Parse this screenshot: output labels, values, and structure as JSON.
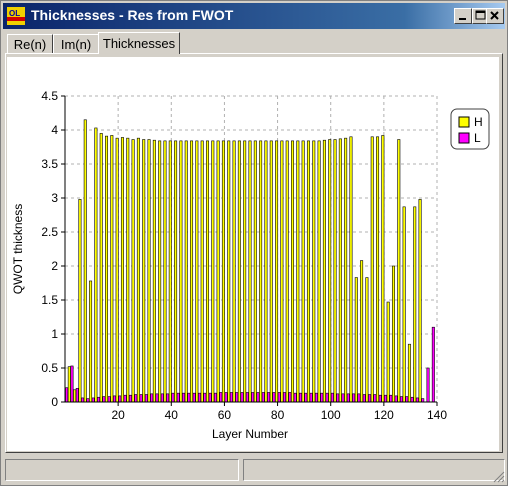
{
  "window": {
    "title": "Thicknesses - Res from FWOT",
    "icon": "ol-app-icon",
    "buttons": [
      "minimize-icon",
      "maximize-icon",
      "close-icon"
    ]
  },
  "tabs": [
    {
      "label": "Re(n)",
      "active": false
    },
    {
      "label": "Im(n)",
      "active": false
    },
    {
      "label": "Thicknesses",
      "active": true
    }
  ],
  "colors": {
    "H": "#ffff00",
    "L": "#ff00ff",
    "grid": "#b0b0b0"
  },
  "chart_data": {
    "type": "bar",
    "xlabel": "Layer Number",
    "ylabel": "QWOT thickness",
    "ylim": [
      0,
      4.5
    ],
    "xlim": [
      0,
      140
    ],
    "yticks": [
      "0",
      "0.5",
      "1",
      "1.5",
      "2",
      "2.5",
      "3",
      "3.5",
      "4",
      "4.5"
    ],
    "xticks": [
      "20",
      "40",
      "60",
      "80",
      "100",
      "120",
      "140"
    ],
    "grid": true,
    "legend_position": "top-right",
    "series": [
      {
        "name": "H",
        "x": [
          2,
          4,
          6,
          8,
          10,
          12,
          14,
          16,
          18,
          20,
          22,
          24,
          26,
          28,
          30,
          32,
          34,
          36,
          38,
          40,
          42,
          44,
          46,
          48,
          50,
          52,
          54,
          56,
          58,
          60,
          62,
          64,
          66,
          68,
          70,
          72,
          74,
          76,
          78,
          80,
          82,
          84,
          86,
          88,
          90,
          92,
          94,
          96,
          98,
          100,
          102,
          104,
          106,
          108,
          110,
          112,
          114,
          116,
          118,
          120,
          122,
          124,
          126,
          128,
          130,
          132,
          134,
          136,
          138,
          140
        ],
        "values": [
          0.52,
          0.18,
          2.98,
          4.15,
          1.78,
          4.03,
          3.95,
          3.91,
          3.92,
          3.88,
          3.89,
          3.88,
          3.86,
          3.88,
          3.86,
          3.86,
          3.85,
          3.84,
          3.84,
          3.84,
          3.84,
          3.84,
          3.84,
          3.84,
          3.84,
          3.84,
          3.84,
          3.84,
          3.84,
          3.84,
          3.84,
          3.84,
          3.84,
          3.84,
          3.84,
          3.84,
          3.84,
          3.84,
          3.84,
          3.84,
          3.84,
          3.84,
          3.84,
          3.84,
          3.84,
          3.84,
          3.84,
          3.84,
          3.85,
          3.86,
          3.86,
          3.87,
          3.88,
          3.9,
          1.83,
          2.08,
          1.83,
          3.9,
          3.9,
          3.92,
          1.47,
          2.0,
          3.86,
          2.87,
          0.85,
          2.87,
          2.98,
          0.0,
          0.0,
          0.0
        ]
      },
      {
        "name": "L",
        "x": [
          1,
          3,
          5,
          7,
          9,
          11,
          13,
          15,
          17,
          19,
          21,
          23,
          25,
          27,
          29,
          31,
          33,
          35,
          37,
          39,
          41,
          43,
          45,
          47,
          49,
          51,
          53,
          55,
          57,
          59,
          61,
          63,
          65,
          67,
          69,
          71,
          73,
          75,
          77,
          79,
          81,
          83,
          85,
          87,
          89,
          91,
          93,
          95,
          97,
          99,
          101,
          103,
          105,
          107,
          109,
          111,
          113,
          115,
          117,
          119,
          121,
          123,
          125,
          127,
          129,
          131,
          133,
          135,
          137,
          139
        ],
        "values": [
          0.21,
          0.53,
          0.2,
          0.06,
          0.05,
          0.06,
          0.07,
          0.08,
          0.08,
          0.09,
          0.09,
          0.1,
          0.1,
          0.11,
          0.11,
          0.11,
          0.12,
          0.12,
          0.12,
          0.12,
          0.13,
          0.13,
          0.13,
          0.13,
          0.13,
          0.13,
          0.13,
          0.13,
          0.13,
          0.14,
          0.14,
          0.14,
          0.14,
          0.14,
          0.14,
          0.14,
          0.14,
          0.14,
          0.14,
          0.14,
          0.14,
          0.14,
          0.14,
          0.13,
          0.13,
          0.13,
          0.13,
          0.13,
          0.13,
          0.13,
          0.13,
          0.12,
          0.12,
          0.12,
          0.12,
          0.12,
          0.11,
          0.11,
          0.11,
          0.1,
          0.1,
          0.1,
          0.09,
          0.08,
          0.08,
          0.07,
          0.06,
          0.05,
          0.5,
          1.1
        ]
      }
    ]
  }
}
